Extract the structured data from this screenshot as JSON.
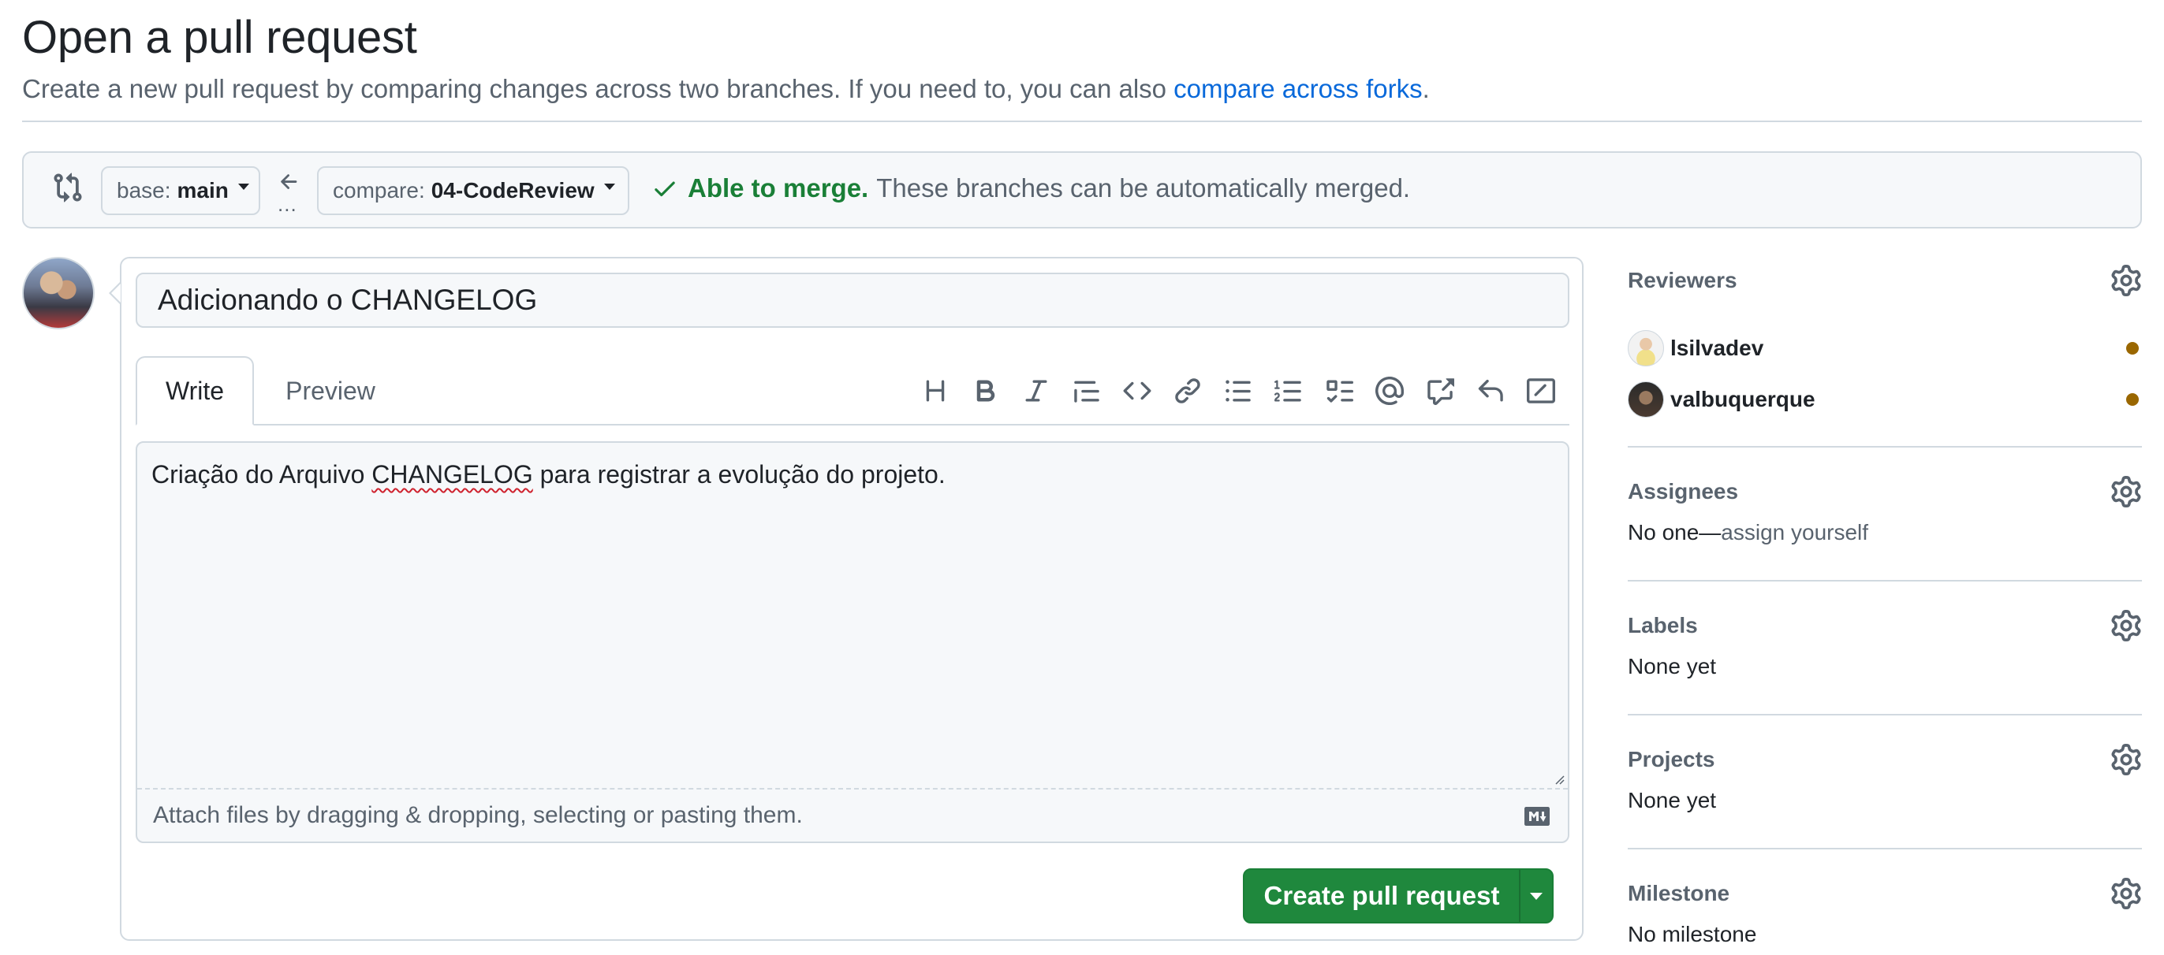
{
  "header": {
    "title": "Open a pull request",
    "subtitle_text": "Create a new pull request by comparing changes across two branches. If you need to, you can also ",
    "subtitle_link": "compare across forks",
    "subtitle_end": "."
  },
  "compare_bar": {
    "base_prefix": "base:",
    "base_branch": "main",
    "compare_prefix": "compare:",
    "compare_branch": "04-CodeReview",
    "ellipsis": "...",
    "merge_ok": "Able to merge.",
    "merge_message": "These branches can be automatically merged."
  },
  "composer": {
    "title_value": "Adicionando o CHANGELOG",
    "tabs": [
      {
        "label": "Write"
      },
      {
        "label": "Preview"
      }
    ],
    "body_before": "Criação do Arquivo ",
    "body_misspelled": "CHANGELOG",
    "body_after": " para registrar a evolução do projeto.",
    "attach_hint": "Attach files by dragging & dropping, selecting or pasting them.",
    "submit_label": "Create pull request"
  },
  "toolbar_icons": [
    "heading-icon",
    "bold-icon",
    "italic-icon",
    "quote-icon",
    "code-icon",
    "link-icon",
    "unordered-list-icon",
    "ordered-list-icon",
    "task-list-icon",
    "mention-icon",
    "cross-reference-icon",
    "saved-replies-icon",
    "slash-command-icon"
  ],
  "sidebar": {
    "reviewers": {
      "heading": "Reviewers",
      "people": [
        {
          "name": "lsilvadev"
        },
        {
          "name": "valbuquerque"
        }
      ]
    },
    "assignees": {
      "heading": "Assignees",
      "value": "No one—",
      "action": "assign yourself"
    },
    "labels": {
      "heading": "Labels",
      "value": "None yet"
    },
    "projects": {
      "heading": "Projects",
      "value": "None yet"
    },
    "milestone": {
      "heading": "Milestone",
      "value": "No milestone"
    }
  },
  "colors": {
    "accent_link": "#0969da",
    "success": "#1a7f37",
    "button_green": "#1f883d",
    "pending_dot": "#9a6700",
    "border": "#d1d9e0",
    "muted_text": "#59636e"
  }
}
